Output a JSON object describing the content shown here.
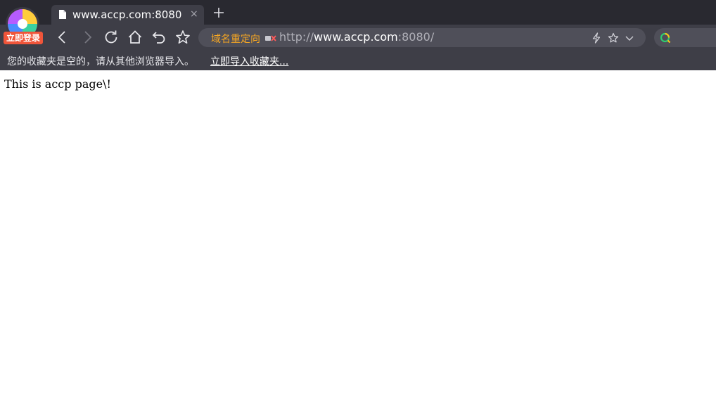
{
  "browser": {
    "login_badge": "立即登录",
    "tab": {
      "title": "www.accp.com:8080",
      "close_glyph": "×"
    },
    "new_tab_icon": "plus-icon",
    "toolbar": {
      "icons": [
        "back-icon",
        "forward-icon",
        "reload-icon",
        "home-icon",
        "undo-icon",
        "star-icon"
      ]
    },
    "address_bar": {
      "redirect_label": "域名重定向",
      "url_scheme": "http://",
      "url_host": "www.accp.com",
      "url_rest": ":8080/",
      "icons": [
        "lightning-icon",
        "favorite-star-icon",
        "chevron-down-icon"
      ]
    },
    "search_icon": "search-icon",
    "bookmarks_bar": {
      "empty_text": "您的收藏夹是空的，请从其他浏览器导入。",
      "import_link": "立即导入收藏夹..."
    }
  },
  "page": {
    "body_text": "This is accp page\\!"
  },
  "colors": {
    "chrome_dark": "#292930",
    "chrome": "#3e3e47",
    "address_bg": "#4f4f59",
    "redirect_orange": "#f5a623",
    "login_red": "#f0553a"
  }
}
